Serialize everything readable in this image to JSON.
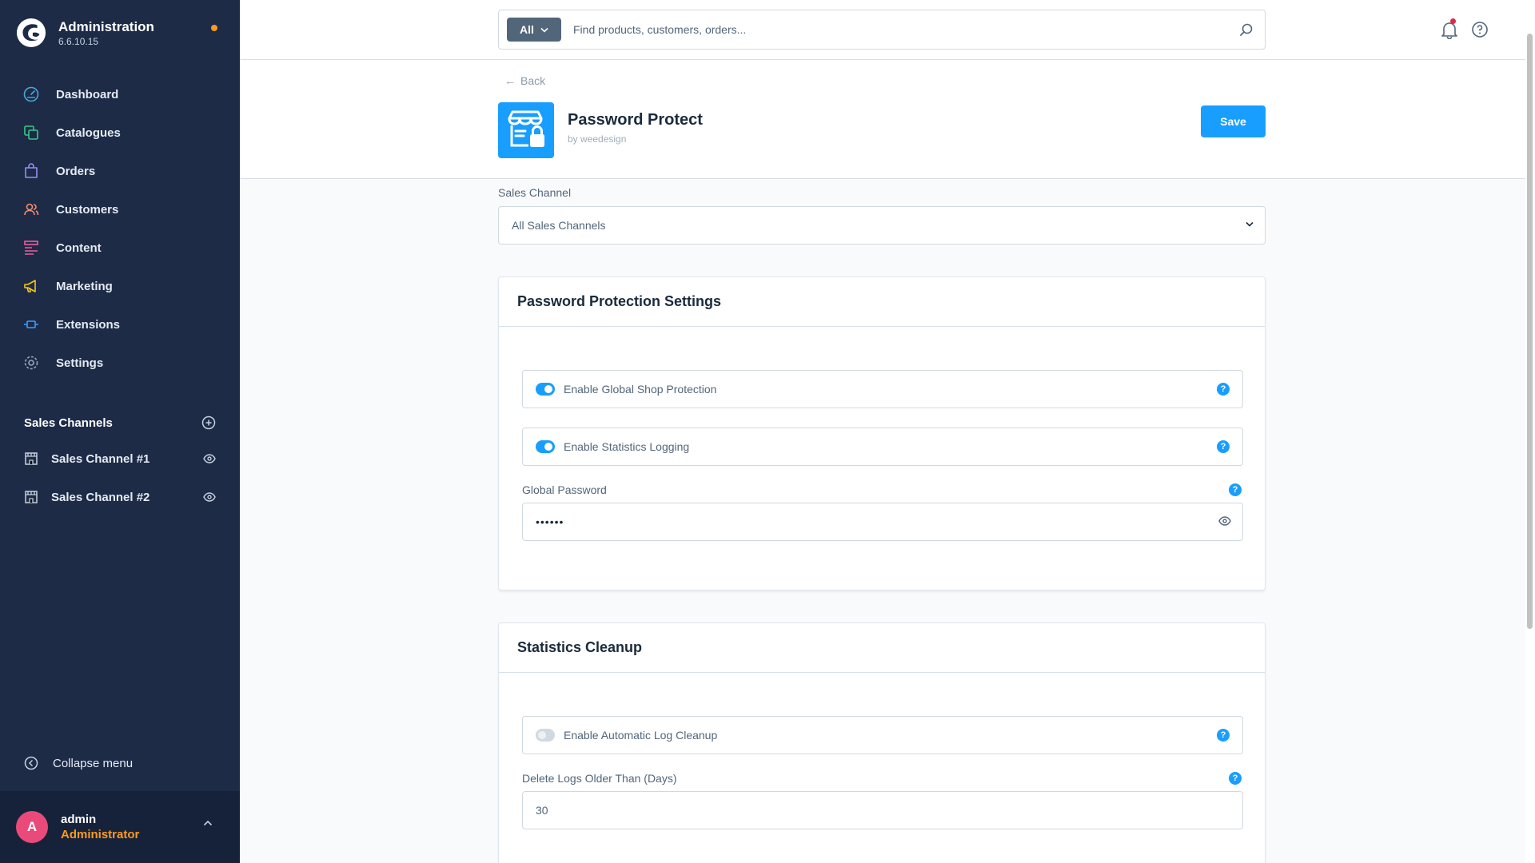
{
  "brand": {
    "title": "Administration",
    "version": "6.6.10.15"
  },
  "nav": {
    "items": [
      {
        "label": "Dashboard",
        "icon": "dashboard-icon",
        "color": "#4aa8d8"
      },
      {
        "label": "Catalogues",
        "icon": "catalogues-icon",
        "color": "#3cc68a"
      },
      {
        "label": "Orders",
        "icon": "orders-icon",
        "color": "#9b8cf2"
      },
      {
        "label": "Customers",
        "icon": "customers-icon",
        "color": "#f28e6b"
      },
      {
        "label": "Content",
        "icon": "content-icon",
        "color": "#f25c9c"
      },
      {
        "label": "Marketing",
        "icon": "marketing-icon",
        "color": "#f5c518"
      },
      {
        "label": "Extensions",
        "icon": "extensions-icon",
        "color": "#3aa0ff"
      },
      {
        "label": "Settings",
        "icon": "settings-icon",
        "color": "#9aa8b8"
      }
    ]
  },
  "sales_channels": {
    "title": "Sales Channels",
    "items": [
      {
        "label": "Sales Channel #1"
      },
      {
        "label": "Sales Channel #2"
      }
    ]
  },
  "collapse_label": "Collapse menu",
  "user": {
    "initial": "A",
    "name": "admin",
    "role": "Administrator"
  },
  "search": {
    "type": "All",
    "placeholder": "Find products, customers, orders..."
  },
  "header": {
    "back": "Back",
    "app_title": "Password Protect",
    "app_by": "by weedesign",
    "save": "Save"
  },
  "sales_channel_field": {
    "label": "Sales Channel",
    "value": "All Sales Channels"
  },
  "protection_card": {
    "title": "Password Protection Settings",
    "global_protection": {
      "label": "Enable Global Shop Protection",
      "enabled": true
    },
    "statistics_logging": {
      "label": "Enable Statistics Logging",
      "enabled": true
    },
    "password": {
      "label": "Global Password",
      "value": "••••••"
    }
  },
  "cleanup_card": {
    "title": "Statistics Cleanup",
    "auto_cleanup": {
      "label": "Enable Automatic Log Cleanup",
      "enabled": false
    },
    "days": {
      "label": "Delete Logs Older Than (Days)",
      "value": "30"
    }
  },
  "colors": {
    "sidebar": "#1d2b47",
    "accent": "#189eff",
    "orange": "#ff9a1f"
  }
}
